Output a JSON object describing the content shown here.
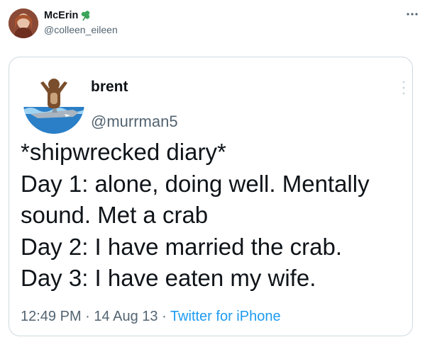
{
  "quoting_user": {
    "display_name": "McErin",
    "handle": "@colleen_eileen",
    "badge_icon": "shamrock-icon",
    "more_icon": "more-horizontal-icon"
  },
  "quoted_tweet": {
    "display_name": "brent",
    "handle": "@murrman5",
    "menu_icon": "more-vertical-icon",
    "lines": [
      "*shipwrecked diary*",
      "Day 1: alone, doing well. Mentally",
      "sound. Met a crab",
      "Day 2: I have married the crab.",
      "Day 3: I have eaten my wife."
    ],
    "time": "12:49 PM",
    "separator": "·",
    "date": "14 Aug 13",
    "source": "Twitter for iPhone"
  },
  "colors": {
    "text": "#0f1419",
    "secondary": "#536471",
    "link": "#1d9bf0",
    "border": "#cfd9de"
  }
}
